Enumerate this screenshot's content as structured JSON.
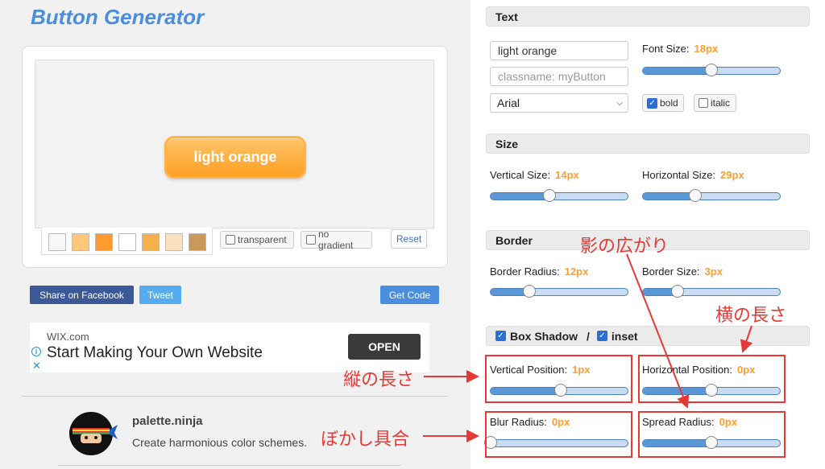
{
  "app": {
    "title": "Button Generator"
  },
  "preview": {
    "button_label": "light orange",
    "swatch_colors": [
      "#f7f7f7",
      "#ffc878",
      "#ff9a2e",
      "#ffffff",
      "#f5b04c",
      "#fde0c0",
      "#c99a57"
    ],
    "transparent_label": "transparent",
    "no_gradient_label": "no gradient",
    "reset_label": "Reset"
  },
  "social": {
    "facebook_label": "Share on Facebook",
    "tweet_label": "Tweet",
    "get_code_label": "Get Code"
  },
  "ad": {
    "brand": "WIX.com",
    "headline": "Start Making Your Own Website",
    "open_label": "OPEN",
    "info_icon": "i",
    "close_icon": "✕"
  },
  "palette": {
    "title": "palette.ninja",
    "subtitle": "Create harmonious color schemes."
  },
  "settings": {
    "text": {
      "header": "Text",
      "text_value": "light orange",
      "classname_placeholder": "classname: myButton",
      "font_family": "Arial",
      "font_size_label": "Font Size:",
      "font_size_value": "18px",
      "font_size_level": 0.5,
      "bold_label": "bold",
      "bold_checked": true,
      "italic_label": "italic",
      "italic_checked": false
    },
    "size": {
      "header": "Size",
      "vertical_label": "Vertical Size:",
      "vertical_value": "14px",
      "vertical_level": 0.43,
      "horizontal_label": "Horizontal Size:",
      "horizontal_value": "29px",
      "horizontal_level": 0.38
    },
    "border": {
      "header": "Border",
      "radius_label": "Border Radius:",
      "radius_value": "12px",
      "radius_level": 0.28,
      "size_label": "Border Size:",
      "size_value": "3px",
      "size_level": 0.25
    },
    "shadow": {
      "header": "Box Shadow",
      "separator": "/",
      "inset_label": "inset",
      "vertical_label": "Vertical Position:",
      "vertical_value": "1px",
      "vertical_level": 0.51,
      "horizontal_label": "Horizontal Position:",
      "horizontal_value": "0px",
      "horizontal_level": 0.5,
      "blur_label": "Blur Radius:",
      "blur_value": "0px",
      "blur_level": 0.0,
      "spread_label": "Spread Radius:",
      "spread_value": "0px",
      "spread_level": 0.5
    }
  },
  "annotations": {
    "spread": "影の広がり",
    "horizontal": "横の長さ",
    "vertical": "縦の長さ",
    "blur": "ぼかし具合",
    "color": "#e53935"
  }
}
